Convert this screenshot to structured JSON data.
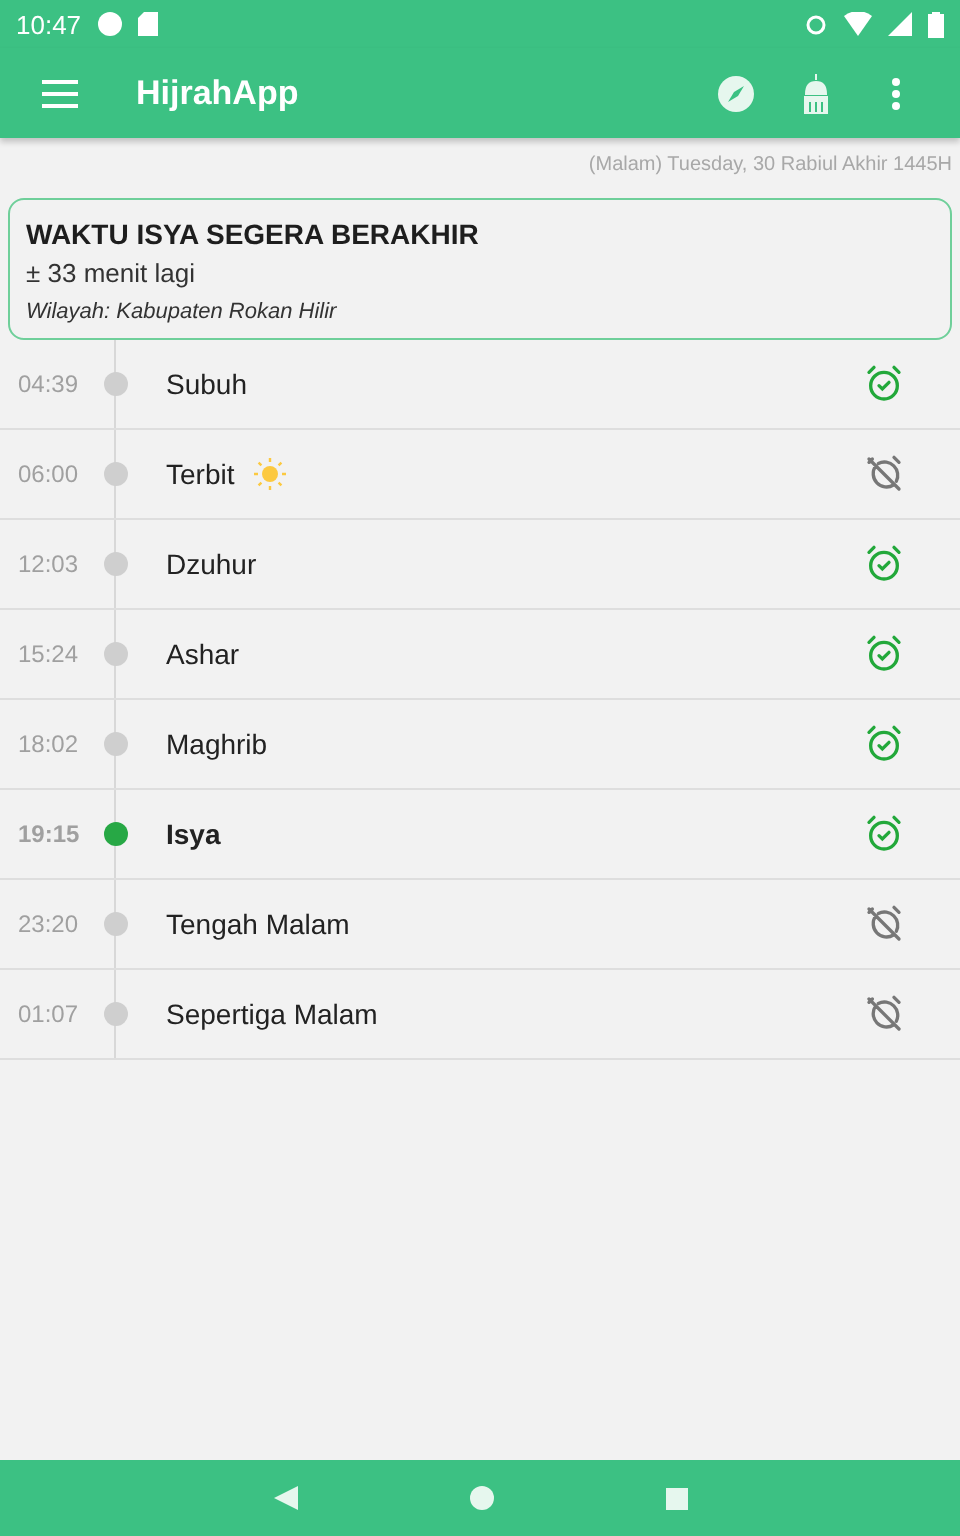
{
  "status_bar": {
    "time": "10:47"
  },
  "app_bar": {
    "title": "HijrahApp"
  },
  "date_line": "(Malam) Tuesday, 30 Rabiul Akhir 1445H",
  "notice": {
    "title": "WAKTU ISYA SEGERA BERAKHIR",
    "remaining": "± 33 menit lagi",
    "region": "Wilayah: Kabupaten Rokan Hilir"
  },
  "prayers": [
    {
      "time": "04:39",
      "name": "Subuh",
      "selected": false,
      "sun": false,
      "alarm": true
    },
    {
      "time": "06:00",
      "name": "Terbit",
      "selected": false,
      "sun": true,
      "alarm": false
    },
    {
      "time": "12:03",
      "name": "Dzuhur",
      "selected": false,
      "sun": false,
      "alarm": true
    },
    {
      "time": "15:24",
      "name": "Ashar",
      "selected": false,
      "sun": false,
      "alarm": true
    },
    {
      "time": "18:02",
      "name": "Maghrib",
      "selected": false,
      "sun": false,
      "alarm": true
    },
    {
      "time": "19:15",
      "name": "Isya",
      "selected": true,
      "sun": false,
      "alarm": true
    },
    {
      "time": "23:20",
      "name": "Tengah Malam",
      "selected": false,
      "sun": false,
      "alarm": false
    },
    {
      "time": "01:07",
      "name": "Sepertiga Malam",
      "selected": false,
      "sun": false,
      "alarm": false
    }
  ]
}
